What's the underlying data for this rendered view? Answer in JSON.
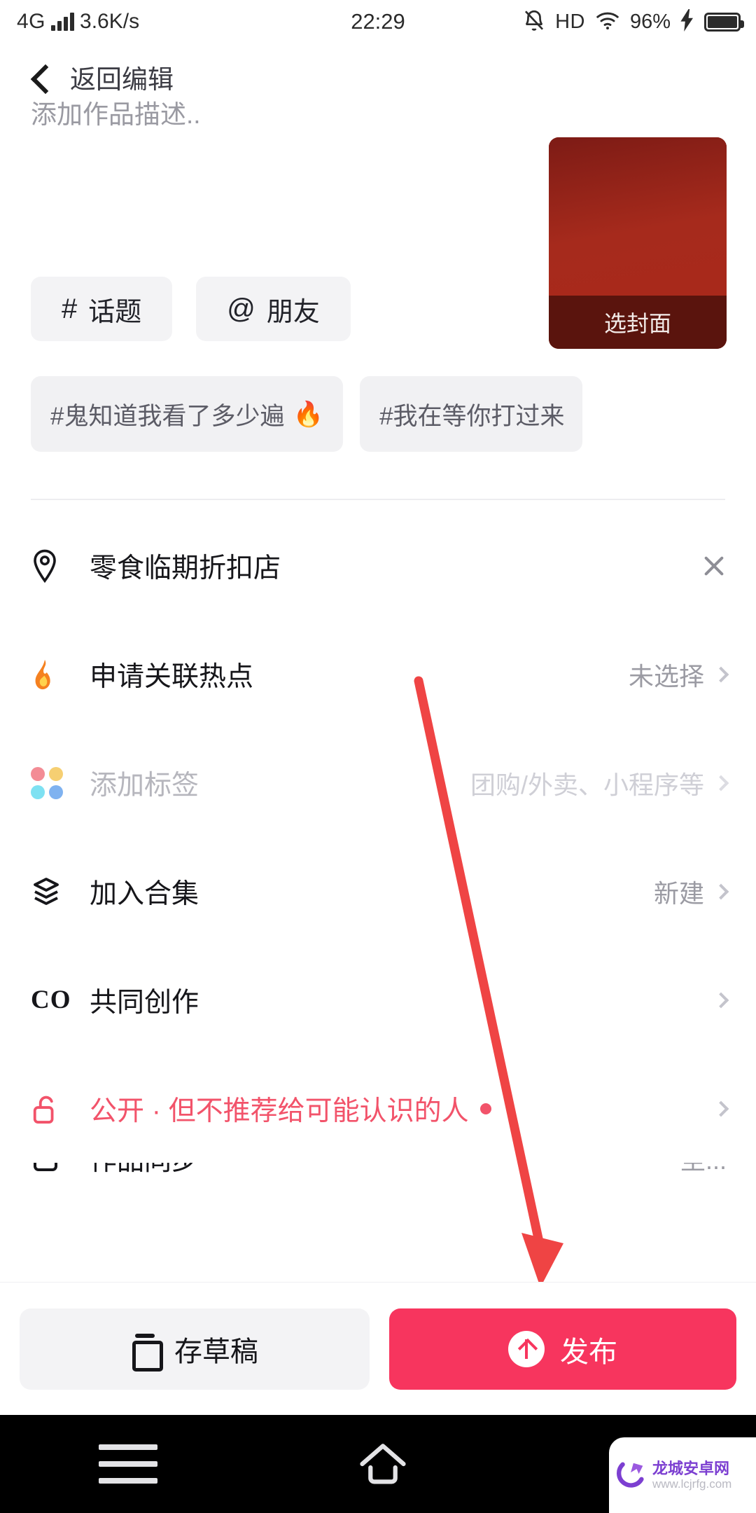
{
  "status_bar": {
    "network_type": "4G",
    "speed": "3.6K/s",
    "time": "22:29",
    "hd": "HD",
    "battery_percent": "96%",
    "icons": [
      "signal-bars-icon",
      "mute-bell-icon",
      "wifi-icon",
      "charging-bolt-icon",
      "battery-icon"
    ]
  },
  "header": {
    "back_label": "返回编辑"
  },
  "description": {
    "placeholder": "添加作品描述..",
    "value": ""
  },
  "cover": {
    "label": "选封面",
    "accent": "#a5291c"
  },
  "chips": [
    {
      "symbol": "#",
      "label": "话题"
    },
    {
      "symbol": "@",
      "label": "朋友"
    }
  ],
  "hashtag_suggestions": [
    {
      "text": "#鬼知道我看了多少遍",
      "emoji": "🔥"
    },
    {
      "text": "#我在等你打过来",
      "emoji": ""
    }
  ],
  "rows": [
    {
      "icon": "location-pin-icon",
      "label": "零食临期折扣店",
      "value": "",
      "action": "close-icon"
    },
    {
      "icon": "flame-icon",
      "label": "申请关联热点",
      "value": "未选择",
      "action": "chevron-right-icon"
    },
    {
      "icon": "color-dots-icon",
      "label": "添加标签",
      "value": "团购/外卖、小程序等",
      "action": "chevron-right-icon"
    },
    {
      "icon": "layers-icon",
      "label": "加入合集",
      "value": "新建",
      "action": "chevron-right-icon"
    },
    {
      "icon": "co-icon",
      "label": "共同创作",
      "value": "",
      "action": "chevron-right-icon"
    },
    {
      "icon": "unlock-icon",
      "label": "公开 · 但不推荐给可能认识的人",
      "value": "",
      "action": "chevron-right-icon"
    },
    {
      "icon": "sync-icon",
      "label": "作品同步",
      "value": "至...",
      "action": "chevron-right-icon"
    }
  ],
  "footer": {
    "draft_label": "存草稿",
    "publish_label": "发布",
    "publish_color": "#f7355e"
  },
  "nav_bar": {
    "items": [
      "menu-icon",
      "home-icon",
      "back-icon"
    ]
  },
  "watermark": {
    "name": "龙城安卓网",
    "url": "www.lcjrfg.com"
  },
  "annotation": {
    "type": "red-arrow",
    "color": "#ef4444",
    "points_to": "发布"
  }
}
